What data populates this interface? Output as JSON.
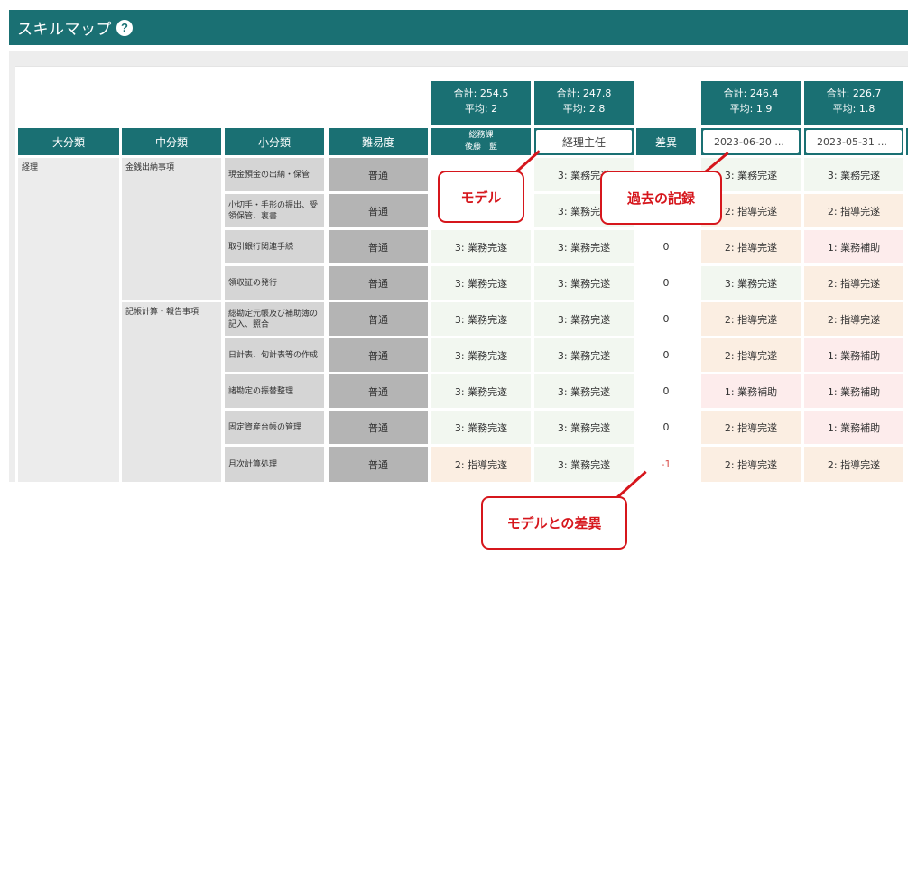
{
  "page": {
    "title": "スキルマップ",
    "help_icon": "?"
  },
  "summaries": [
    {
      "total": "合計: 254.5",
      "avg": "平均: 2"
    },
    {
      "total": "合計: 247.8",
      "avg": "平均: 2.8"
    },
    {
      "total": "合計: 246.4",
      "avg": "平均: 1.9"
    },
    {
      "total": "合計: 226.7",
      "avg": "平均: 1.8"
    }
  ],
  "headers": {
    "major": "大分類",
    "mid": "中分類",
    "small": "小分類",
    "difficulty": "難易度",
    "person_dept": "総務課",
    "person_name": "後藤　藍",
    "model_select": "経理主任",
    "diff": "差異",
    "record_1": "2023-06-20 ...",
    "record_2": "2023-05-31 ..."
  },
  "major_category": "経理",
  "mid_categories": [
    "金銭出納事項",
    "記帳計算・報告事項"
  ],
  "rows": [
    {
      "small": "現金預金の出納・保管",
      "level": "普通",
      "person": "",
      "model": "3: 業務完遂",
      "diff": "",
      "rec1": "3: 業務完遂",
      "rec2": "3: 業務完遂"
    },
    {
      "small": "小切手・手形の振出、受領保管、裏書",
      "level": "普通",
      "person": "",
      "model": "3: 業務完遂",
      "diff": "",
      "rec1": "2: 指導完遂",
      "rec2": "2: 指導完遂"
    },
    {
      "small": "取引銀行関連手続",
      "level": "普通",
      "person": "3: 業務完遂",
      "model": "3: 業務完遂",
      "diff": "0",
      "rec1": "2: 指導完遂",
      "rec2": "1: 業務補助"
    },
    {
      "small": "領収証の発行",
      "level": "普通",
      "person": "3: 業務完遂",
      "model": "3: 業務完遂",
      "diff": "0",
      "rec1": "3: 業務完遂",
      "rec2": "2: 指導完遂"
    },
    {
      "small": "総勘定元帳及び補助簿の記入、照合",
      "level": "普通",
      "person": "3: 業務完遂",
      "model": "3: 業務完遂",
      "diff": "0",
      "rec1": "2: 指導完遂",
      "rec2": "2: 指導完遂"
    },
    {
      "small": "日計表、旬計表等の作成",
      "level": "普通",
      "person": "3: 業務完遂",
      "model": "3: 業務完遂",
      "diff": "0",
      "rec1": "2: 指導完遂",
      "rec2": "1: 業務補助"
    },
    {
      "small": "諸勘定の振替整理",
      "level": "普通",
      "person": "3: 業務完遂",
      "model": "3: 業務完遂",
      "diff": "0",
      "rec1": "1: 業務補助",
      "rec2": "1: 業務補助"
    },
    {
      "small": "固定資産台帳の管理",
      "level": "普通",
      "person": "3: 業務完遂",
      "model": "3: 業務完遂",
      "diff": "0",
      "rec1": "2: 指導完遂",
      "rec2": "1: 業務補助"
    },
    {
      "small": "月次計算処理",
      "level": "普通",
      "person": "2: 指導完遂",
      "model": "3: 業務完遂",
      "diff": "-1",
      "rec1": "2: 指導完遂",
      "rec2": "2: 指導完遂"
    }
  ],
  "callouts": {
    "model": "モデル",
    "past": "過去の記録",
    "diff": "モデルとの差異"
  }
}
